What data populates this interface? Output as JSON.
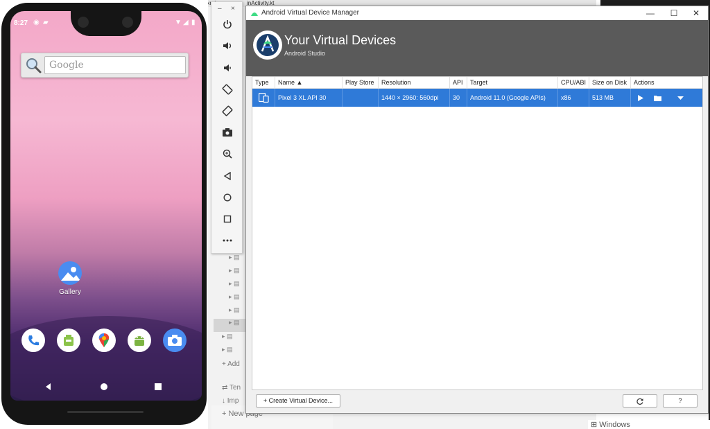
{
  "background": {
    "tab_fragment_1": "e.xml",
    "tab_fragment_2": "inActivity.kt",
    "tree_item_add": "Add",
    "tree_item_ten": "Ten",
    "tree_item_imp": "Imp",
    "new_page": "New page",
    "windows_text": "Windows"
  },
  "phone": {
    "time": "8:27",
    "search_placeholder": "Google",
    "gallery_label": "Gallery",
    "status_icons": [
      "sync-icon",
      "sim-icon",
      "wifi-icon",
      "signal-icon",
      "battery-icon"
    ],
    "dock_apps": [
      "phone-app-icon",
      "store-app-icon",
      "maps-app-icon",
      "android-app-icon",
      "camera-app-icon"
    ]
  },
  "emulator_toolbar": {
    "minimize": "–",
    "close": "×",
    "buttons": [
      "power-icon",
      "volume-up-icon",
      "volume-down-icon",
      "rotate-left-icon",
      "rotate-right-icon",
      "screenshot-icon",
      "zoom-icon",
      "back-icon",
      "home-icon",
      "overview-icon",
      "more-icon"
    ]
  },
  "avd_manager": {
    "window_title": "Android Virtual Device Manager",
    "heading": "Your Virtual Devices",
    "subheading": "Android Studio",
    "columns": [
      "Type",
      "Name ▲",
      "Play Store",
      "Resolution",
      "API",
      "Target",
      "CPU/ABI",
      "Size on Disk",
      "Actions"
    ],
    "devices": [
      {
        "type": "phone-tablet-icon",
        "name": "Pixel 3 XL API 30",
        "play_store": "",
        "resolution": "1440 × 2960: 560dpi",
        "api": "30",
        "target": "Android 11.0 (Google APIs)",
        "cpu_abi": "x86",
        "size_on_disk": "513 MB",
        "actions": [
          "play-icon",
          "folder-icon",
          "dropdown-icon"
        ]
      }
    ],
    "create_button": "+ Create Virtual Device...",
    "help_button": "?",
    "accent_color": "#2f7ad8",
    "header_color": "#5a5a5a"
  }
}
